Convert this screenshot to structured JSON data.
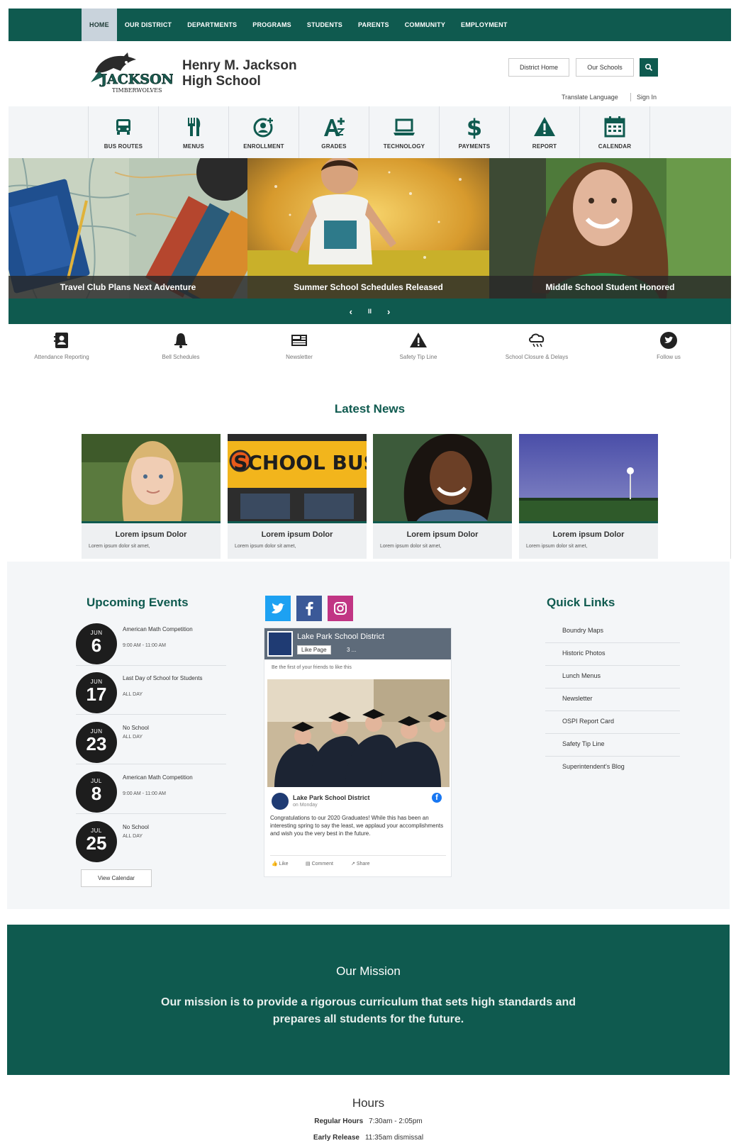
{
  "nav": {
    "items": [
      "HOME",
      "OUR DISTRICT",
      "DEPARTMENTS",
      "PROGRAMS",
      "STUDENTS",
      "PARENTS",
      "COMMUNITY",
      "EMPLOYMENT"
    ],
    "active": "HOME"
  },
  "header": {
    "logo_text": "JACKSON",
    "logo_subtext": "TIMBERWOLVES",
    "school_name_line1": "Henry M. Jackson",
    "school_name_line2": "High School",
    "district_home_label": "District Home",
    "our_schools_label": "Our Schools",
    "translate_label": "Translate Language",
    "sign_in_label": "Sign In"
  },
  "quick_icons": [
    {
      "label": "BUS ROUTES",
      "icon": "bus-icon"
    },
    {
      "label": "MENUS",
      "icon": "fork-knife-icon"
    },
    {
      "label": "ENROLLMENT",
      "icon": "enrollment-icon"
    },
    {
      "label": "GRADES",
      "icon": "grades-icon"
    },
    {
      "label": "TECHNOLOGY",
      "icon": "laptop-icon"
    },
    {
      "label": "PAYMENTS",
      "icon": "dollar-icon"
    },
    {
      "label": "REPORT",
      "icon": "warning-icon"
    },
    {
      "label": "CALENDAR",
      "icon": "calendar-icon"
    }
  ],
  "hero": {
    "slides": [
      {
        "caption": "Travel Club Plans Next Adventure"
      },
      {
        "caption": "Summer School Schedules Released"
      },
      {
        "caption": "Middle School Student Honored"
      }
    ],
    "controls": {
      "prev": "‹",
      "pause": "II",
      "next": "›"
    }
  },
  "quick_links_row": [
    {
      "label": "Attendance Reporting",
      "icon": "contact-card-icon"
    },
    {
      "label": "Bell Schedules",
      "icon": "bell-icon"
    },
    {
      "label": "Newsletter",
      "icon": "newspaper-icon"
    },
    {
      "label": "Safety Tip Line",
      "icon": "warning-icon"
    },
    {
      "label": "School Closure & Delays",
      "icon": "snow-cloud-icon"
    },
    {
      "label": "Follow us",
      "icon": "twitter-icon"
    }
  ],
  "latest_news": {
    "title": "Latest News",
    "items": [
      {
        "title": "Lorem ipsum Dolor",
        "text": "Lorem ipsum dolor sit amet,"
      },
      {
        "title": "Lorem ipsum Dolor",
        "text": "Lorem ipsum dolor sit amet,",
        "image_text": "SCHOOL BUS"
      },
      {
        "title": "Lorem ipsum Dolor",
        "text": "Lorem ipsum dolor sit amet,"
      },
      {
        "title": "Lorem ipsum Dolor",
        "text": "Lorem ipsum dolor sit amet,"
      }
    ]
  },
  "events": {
    "title": "Upcoming Events",
    "items": [
      {
        "month": "JUN",
        "day": "6",
        "name": "American Math Competition",
        "time": "9:00 AM - 11:00 AM"
      },
      {
        "month": "JUN",
        "day": "17",
        "name": "Last Day of School for Students",
        "time": "ALL DAY"
      },
      {
        "month": "JUN",
        "day": "23",
        "name": "No School",
        "time": "ALL DAY"
      },
      {
        "month": "JUL",
        "day": "8",
        "name": "American Math Competition",
        "time": "9:00 AM - 11:00 AM"
      },
      {
        "month": "JUL",
        "day": "25",
        "name": "No School",
        "time": "ALL DAY"
      }
    ],
    "view_calendar_label": "View Calendar"
  },
  "facebook": {
    "page_name": "Lake Park School District",
    "like_page_label": "Like Page",
    "likes_suffix": "3 ...",
    "friends_text": "Be the first of your friends to like this",
    "post_author": "Lake Park School District",
    "post_date": "on Monday",
    "post_text": "Congratulations to our 2020 Graduates! While this has been an interesting spring to say the least, we applaud your accomplishments and wish you the very best in the future.",
    "like_label": "Like",
    "comment_label": "Comment",
    "share_label": "Share"
  },
  "quick_links": {
    "title": "Quick Links",
    "items": [
      "Boundry Maps",
      "Historic Photos",
      "Lunch Menus",
      "Newsletter",
      "OSPI Report Card",
      "Safety Tip Line",
      "Superintendent's Blog"
    ]
  },
  "mission": {
    "title": "Our Mission",
    "text": "Our mission is to provide a rigorous curriculum that sets high standards and prepares all students for the future."
  },
  "hours": {
    "title": "Hours",
    "regular_label": "Regular Hours",
    "regular_value": "7:30am - 2:05pm",
    "early_label": "Early Release",
    "early_value": "11:35am dismissal"
  },
  "colors": {
    "brand_green": "#0f5a4f",
    "accent_teal": "#0f5a4f",
    "twitter": "#1da1f2",
    "facebook": "#3b5998",
    "instagram": "#c13584"
  }
}
